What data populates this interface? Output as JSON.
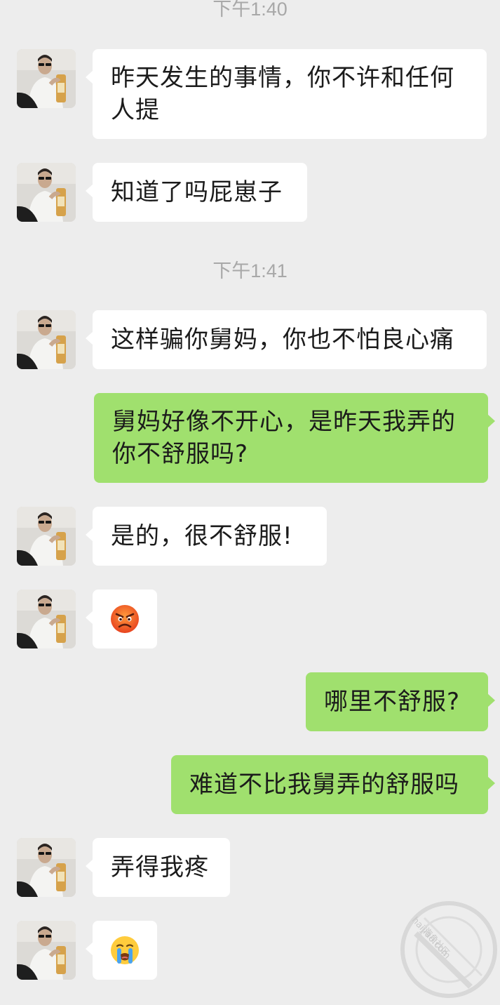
{
  "chat": {
    "timestamp_1": "下午1:40",
    "timestamp_2": "下午1:41",
    "messages": [
      {
        "sender": "contact",
        "text": "昨天发生的事情，你不许和任何人提"
      },
      {
        "sender": "contact",
        "text": "知道了吗屁崽子"
      },
      {
        "sender": "contact",
        "text": "这样骗你舅妈，你也不怕良心痛"
      },
      {
        "sender": "me",
        "text": "舅妈好像不开心，是昨天我弄的你不舒服吗?"
      },
      {
        "sender": "contact",
        "text": "是的，很不舒服!"
      },
      {
        "sender": "contact",
        "emoji": "angry-face-emoji"
      },
      {
        "sender": "me",
        "text": "哪里不舒服?"
      },
      {
        "sender": "me",
        "text": "难道不比我舅弄的舒服吗"
      },
      {
        "sender": "contact",
        "text": "弄得我疼"
      },
      {
        "sender": "contact",
        "emoji": "loudly-crying-face-emoji"
      }
    ]
  },
  "watermark": {
    "line1": "海角社区",
    "line2": "haijiao.com"
  },
  "colors": {
    "background": "#ededed",
    "incoming_bubble": "#ffffff",
    "outgoing_bubble": "#a0e06e",
    "timestamp": "#a8a8a8"
  }
}
